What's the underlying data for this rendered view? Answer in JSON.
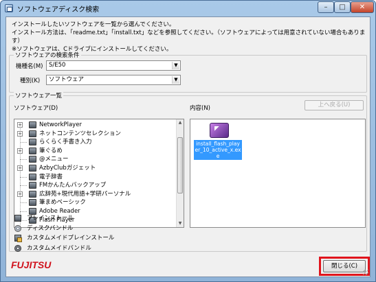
{
  "window": {
    "title": "ソフトウェアディスク検索",
    "min_glyph": "–",
    "max_glyph": "□",
    "close_glyph": "✕"
  },
  "intro": {
    "line1": "インストールしたいソフトウェアを一覧から選んでください。",
    "line2": "インストール方法は、「readme.txt」「install.txt」などを参照してください。（ソフトウェアによっては用意されていない場合もあります）",
    "line3": "※ソフトウェアは、Cドライブにインストールしてください。"
  },
  "search": {
    "group_title": "ソフトウェアの検索条件",
    "model_label": "機種名(M)",
    "model_value": "S/E50",
    "type_label": "種別(K)",
    "type_value": "ソフトウェア"
  },
  "software_list": {
    "group_title": "ソフトウェア一覧",
    "tree_label": "ソフトウェア(D)",
    "content_label": "内容(N)",
    "up_button": "上へ戻る(U)",
    "items": [
      {
        "label": "NetworkPlayer",
        "expander": "+"
      },
      {
        "label": "ネットコンテンツセレクション",
        "expander": "+"
      },
      {
        "label": "らくらく手書き入力",
        "expander": ""
      },
      {
        "label": "筆ぐるめ",
        "expander": "+"
      },
      {
        "label": "@メニュー",
        "expander": ""
      },
      {
        "label": "AzbyClubガジェット",
        "expander": "+"
      },
      {
        "label": "電子辞書",
        "expander": ""
      },
      {
        "label": "FMかんたんバックアップ",
        "expander": ""
      },
      {
        "label": "広辞苑+現代用語+学研パーソナル",
        "expander": "+"
      },
      {
        "label": "筆まめベーシック",
        "expander": ""
      },
      {
        "label": "Adobe Reader",
        "expander": ""
      },
      {
        "label": "Flash Player",
        "expander": ""
      }
    ],
    "scroll_up": "▲",
    "scroll_down": "▼",
    "selected_file": "install_flash_player_10_active_x.exe"
  },
  "legend": [
    {
      "icon": "preinstall-icon",
      "label": "プレインストール"
    },
    {
      "icon": "disc-bundle-icon",
      "label": "ディスクバンドル"
    },
    {
      "icon": "custom-preinstall-icon",
      "label": "カスタムメイドプレインストール"
    },
    {
      "icon": "custom-bundle-icon",
      "label": "カスタムメイドバンドル"
    }
  ],
  "footer": {
    "logo": "FUJITSU",
    "close_button": "閉じる(C)"
  },
  "colors": {
    "highlight": "#e0141c",
    "selection": "#3399ff",
    "logo": "#d0111b"
  }
}
